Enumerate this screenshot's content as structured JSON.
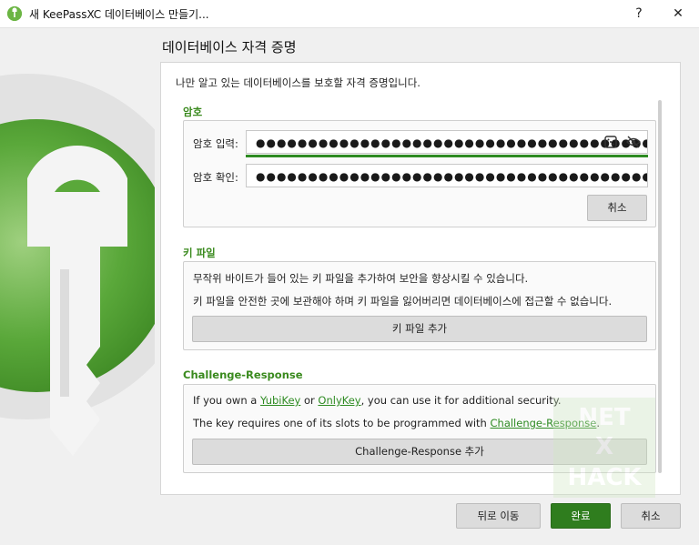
{
  "window": {
    "title": "새 KeePassXC 데이터베이스 만들기...",
    "help_label": "?",
    "close_label": "✕"
  },
  "heading": "데이터베이스 자격 증명",
  "intro": "나만 알고 있는 데이터베이스를 보호할 자격 증명입니다.",
  "password": {
    "section_label": "암호",
    "enter_label": "암호 입력:",
    "enter_value": "●●●●●●●●●●●●●●●●●●●●●●●●●●●●●●●●●●●●●●●●",
    "confirm_label": "암호 확인:",
    "confirm_value": "●●●●●●●●●●●●●●●●●●●●●●●●●●●●●●●●●●●●●●●●",
    "cancel_label": "취소",
    "strength": 1.0
  },
  "keyfile": {
    "section_label": "키 파일",
    "line1": "무작위 바이트가 들어 있는 키 파일을 추가하여 보안을 향상시킬 수 있습니다.",
    "line2": "키 파일을 안전한 곳에 보관해야 하며 키 파일을 잃어버리면 데이터베이스에 접근할 수 없습니다.",
    "add_label": "키 파일 추가"
  },
  "challenge": {
    "section_label": "Challenge-Response",
    "line1_a": "If you own a ",
    "link_yubikey": "YubiKey",
    "line1_b": " or ",
    "link_onlykey": "OnlyKey",
    "line1_c": ", you can use it for additional security.",
    "line2_a": "The key requires one of its slots to be programmed with ",
    "link_cr": "Challenge-Response",
    "line2_b": ".",
    "add_label": "Challenge-Response 추가"
  },
  "footer": {
    "back_label": "뒤로 이동",
    "finish_label": "완료",
    "cancel_label": "취소"
  },
  "watermark": {
    "line1": "NET",
    "line2": "X",
    "line3": "HACK"
  },
  "colors": {
    "accent": "#2f7d1e",
    "link": "#2e8b22",
    "strength": "#2e8b22"
  }
}
